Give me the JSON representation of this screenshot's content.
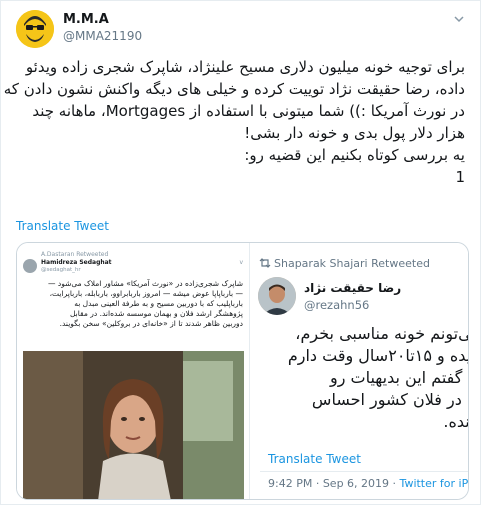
{
  "tweet": {
    "name": "M.M.A",
    "handle": "@MMA21190",
    "text_lines": [
      "برای توجیه خونه میلیون دلاری مسیح علینژاد، شاپرک شجری زاده ویدئو",
      "داده، رضا حقیقت نژاد توییت کرده و خیلی  های دیگه واکنش نشون دادن که",
      "در نورث آمریکا :)) شما میتونی با استفاده از Mortgages، ماهانه چند",
      "هزار دلار پول بدی و خونه دار بشی!",
      "یه بررسی کوتاه بکنیم این قضیه رو:",
      "1"
    ],
    "translate_label": "Translate Tweet"
  },
  "embedded_left": {
    "retweet_note": "A.Dastaran Retweeted",
    "name": "Hamidreza Sedaghat",
    "handle": "@sedaghat_hr",
    "chevron": "v",
    "text_lines": [
      "شاپرک شجری‌زاده در «نورث آمریکا» مشاور املاک می‌شود —",
      "— بارباپاپا عوض میشه — امروز باربابراوو، باربابله، بارباپرایت،",
      "بارباپلیب که با دوربین مسیح و به طرفة العینی مبدل به",
      "پژوهشگر ارشد فلان و بهمان موسسه شده‌اند. در مقابل",
      "دوربین ظاهر شدند تا از «خانه‌ای در بروکلین» سخن بگویند."
    ]
  },
  "embedded_right": {
    "retweet_note": "Shaparak Shajari Retweeted",
    "name": "رضا حقیقت نژاد",
    "handle": "@rezahn56",
    "text_lines": [
      "می‌تونم خونه مناسبی بخرم،",
      "میده و ۱۵تا۲۰سال وقت دارم",
      "ی گفتم این بدیهیات رو",
      "نه در فلان کشور احساس",
      "، نده."
    ],
    "translate_label": "Translate Tweet",
    "time": "9:42 PM",
    "date": "Sep 6, 2019",
    "source": "Twitter for iPhone"
  },
  "colors": {
    "link": "#1b95e0",
    "secondary": "#657786",
    "avatar_bg": "#f5c518"
  }
}
